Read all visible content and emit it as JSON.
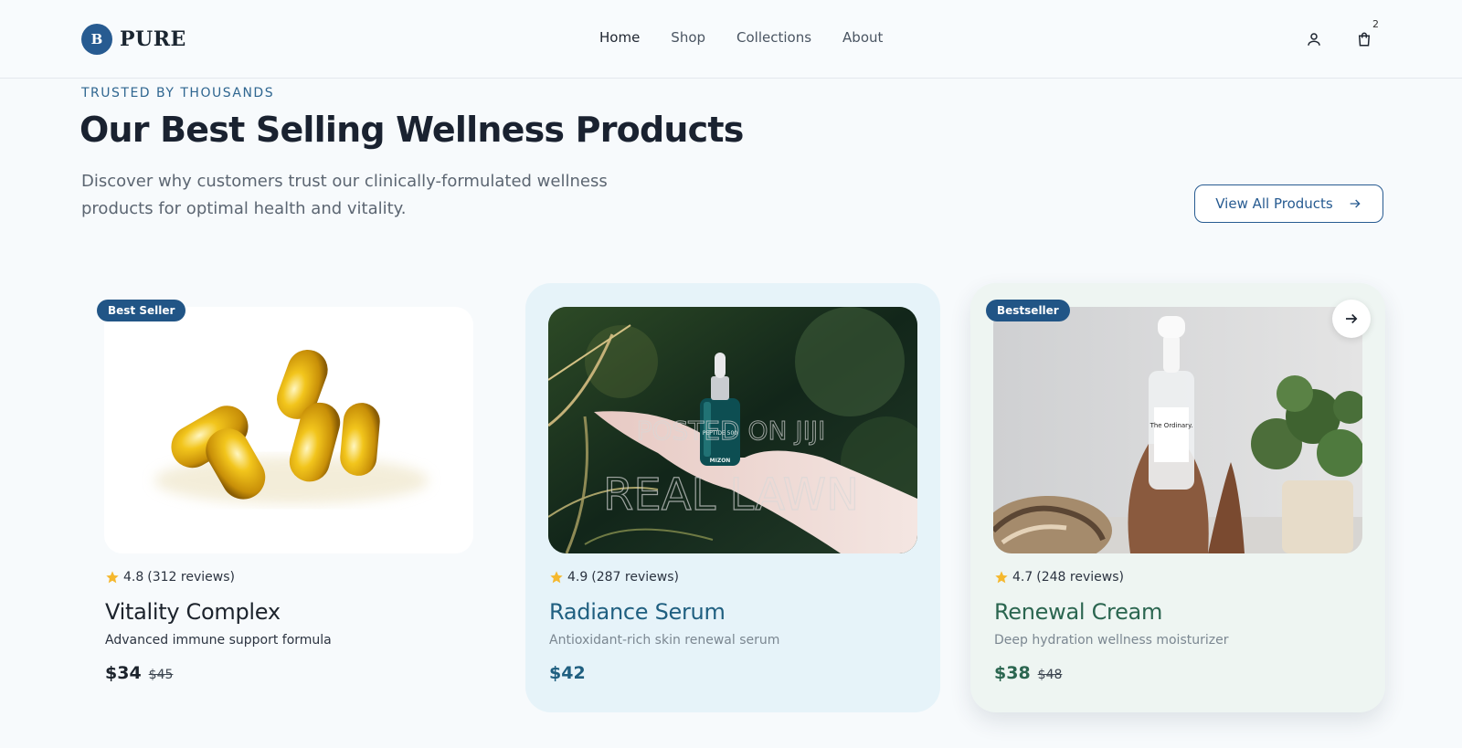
{
  "brand": {
    "mark": "B",
    "name": "PURE"
  },
  "nav": {
    "items": [
      "Home",
      "Shop",
      "Collections",
      "About"
    ]
  },
  "cart": {
    "count": "2"
  },
  "intro": {
    "eyebrow": "TRUSTED BY THOUSANDS",
    "title": "Our Best Selling Wellness Products",
    "subtitle": "Discover why customers trust our clinically-formulated wellness products for optimal health and vitality.",
    "view_all_label": "View All Products"
  },
  "products": [
    {
      "badge": "Best Seller",
      "rating": "4.8",
      "reviews": "(312 reviews)",
      "name": "Vitality Complex",
      "description": "Advanced immune support formula",
      "price": "$34",
      "old_price": "$45"
    },
    {
      "badge": "",
      "rating": "4.9",
      "reviews": "(287 reviews)",
      "name": "Radiance Serum",
      "description": "Antioxidant-rich skin renewal serum",
      "price": "$42",
      "old_price": "",
      "watermark_1": "POSTED ON JIJI",
      "watermark_2": "REAL LAWN",
      "bottle_brand": "MIZON",
      "bottle_label": "PEPTIDE 500"
    },
    {
      "badge": "Bestseller",
      "rating": "4.7",
      "reviews": "(248 reviews)",
      "name": "Renewal Cream",
      "description": "Deep hydration wellness moisturizer",
      "price": "$38",
      "old_price": "$48",
      "bottle_brand": "The Ordinary."
    }
  ],
  "colors": {
    "accent": "#275b91",
    "star": "#f5b82e"
  }
}
